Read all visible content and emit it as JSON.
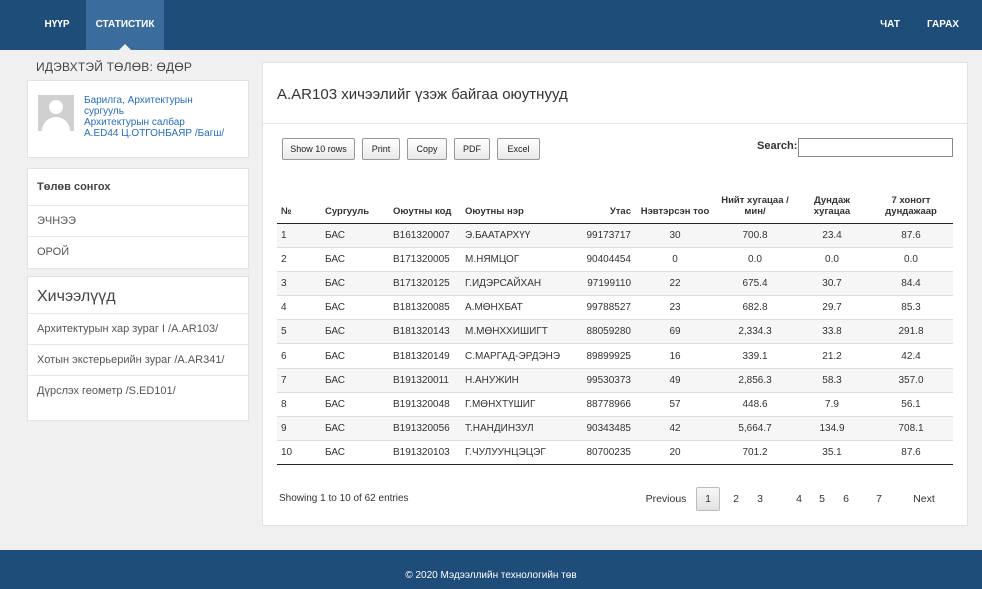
{
  "nav": {
    "home": "НҮҮР",
    "statistics": "СТАТИСТИК",
    "chat": "ЧАТ",
    "logout": "ГАРАХ"
  },
  "sidebar": {
    "semester_title": "ИДЭВХТЭЙ ТӨЛӨВ: ӨДӨР",
    "profile": {
      "line1": "Барилга, Архитектурын",
      "line2": "сургууль",
      "line3": "Архитектурын салбар",
      "line4": "А.ED44 Ц.ОТГОНБАЯР /Багш/"
    },
    "semester_select": {
      "heading": "Төлөв сонгох",
      "items": [
        "ЭЧНЭЭ",
        "ОРОЙ"
      ]
    },
    "courses": {
      "heading": "Хичээлүүд",
      "items": [
        "Архитектурын хар зураг I /A.AR103/",
        "Хотын экстерьерийн зураг /A.AR341/",
        "Дүрслэх геометр /S.ED101/"
      ]
    }
  },
  "main": {
    "title": "A.AR103 хичээлийг үзэж байгаа оюутнууд",
    "buttons": {
      "show": "Show 10 rows",
      "print": "Print",
      "copy": "Copy",
      "pdf": "PDF",
      "excel": "Excel"
    },
    "search_label": "Search:",
    "search_value": "",
    "table": {
      "headers": {
        "no": "№",
        "school": "Сургууль",
        "code": "Оюутны код",
        "name": "Оюутны нэр",
        "phone": "Утас",
        "logins": "Нэвтэрсэн тоо",
        "total": "Нийт хугацаа /мин/",
        "avg": "Дундаж хугацаа",
        "week": "7 хоногт дундажаар"
      },
      "rows": [
        {
          "no": "1",
          "school": "БАС",
          "code": "B161320007",
          "name": "Э.БААТАРХҮҮ",
          "phone": "99173717",
          "logins": "30",
          "total": "700.8",
          "avg": "23.4",
          "week": "87.6"
        },
        {
          "no": "2",
          "school": "БАС",
          "code": "B171320005",
          "name": "М.НЯМЦОГ",
          "phone": "90404454",
          "logins": "0",
          "total": "0.0",
          "avg": "0.0",
          "week": "0.0"
        },
        {
          "no": "3",
          "school": "БАС",
          "code": "B171320125",
          "name": "Г.ИДЭРСАЙХАН",
          "phone": "97199110",
          "logins": "22",
          "total": "675.4",
          "avg": "30.7",
          "week": "84.4"
        },
        {
          "no": "4",
          "school": "БАС",
          "code": "B181320085",
          "name": "А.МӨНХБАТ",
          "phone": "99788527",
          "logins": "23",
          "total": "682.8",
          "avg": "29.7",
          "week": "85.3"
        },
        {
          "no": "5",
          "school": "БАС",
          "code": "B181320143",
          "name": "М.МӨНХХИШИГТ",
          "phone": "88059280",
          "logins": "69",
          "total": "2,334.3",
          "avg": "33.8",
          "week": "291.8"
        },
        {
          "no": "6",
          "school": "БАС",
          "code": "B181320149",
          "name": "С.МАРГАД-ЭРДЭНЭ",
          "phone": "89899925",
          "logins": "16",
          "total": "339.1",
          "avg": "21.2",
          "week": "42.4"
        },
        {
          "no": "7",
          "school": "БАС",
          "code": "B191320011",
          "name": "Н.АНУЖИН",
          "phone": "99530373",
          "logins": "49",
          "total": "2,856.3",
          "avg": "58.3",
          "week": "357.0"
        },
        {
          "no": "8",
          "school": "БАС",
          "code": "B191320048",
          "name": "Г.МӨНХТҮШИГ",
          "phone": "88778966",
          "logins": "57",
          "total": "448.6",
          "avg": "7.9",
          "week": "56.1"
        },
        {
          "no": "9",
          "school": "БАС",
          "code": "B191320056",
          "name": "Т.НАНДИНЗУЛ",
          "phone": "90343485",
          "logins": "42",
          "total": "5,664.7",
          "avg": "134.9",
          "week": "708.1"
        },
        {
          "no": "10",
          "school": "БАС",
          "code": "B191320103",
          "name": "Г.ЧУЛУУНЦЭЦЭГ",
          "phone": "80700235",
          "logins": "20",
          "total": "701.2",
          "avg": "35.1",
          "week": "87.6"
        }
      ]
    },
    "info": "Showing 1 to 10 of 62 entries",
    "pagination": {
      "previous": "Previous",
      "pages": [
        "1",
        "2",
        "3",
        "4",
        "5",
        "6",
        "7"
      ],
      "current": "1",
      "next": "Next"
    }
  },
  "footer": {
    "text": "© 2020 Мэдээллийн технологийн төв"
  },
  "colors": {
    "navbar": "#1f4d7a",
    "active_tab": "#3a6d9c",
    "link": "#2a6db0",
    "background": "#f0f0f0"
  }
}
